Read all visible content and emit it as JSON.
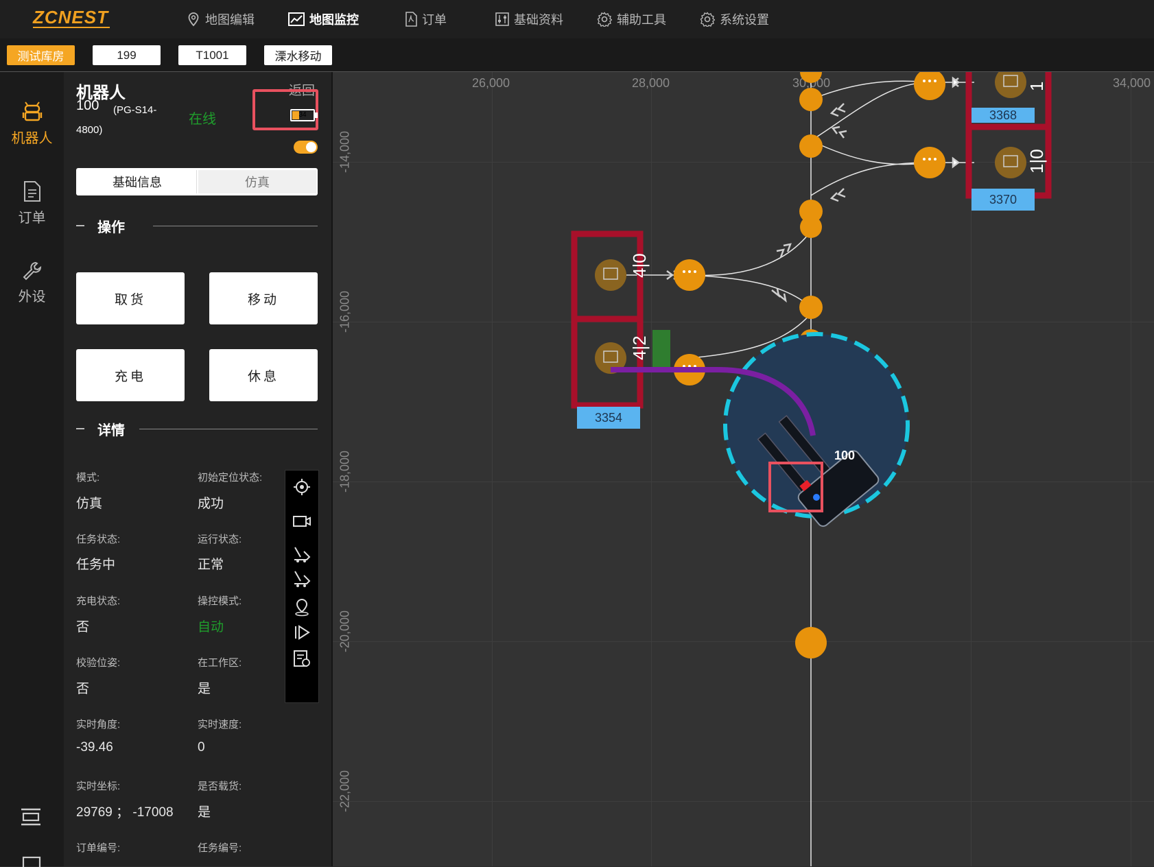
{
  "app": {
    "logo_text": "ZCNEST"
  },
  "nav": [
    {
      "label": "地图编辑",
      "icon": "map-pin-icon"
    },
    {
      "label": "地图监控",
      "icon": "chart-line-icon",
      "active": true
    },
    {
      "label": "订单",
      "icon": "pdf-document-icon"
    },
    {
      "label": "基础资料",
      "icon": "sliders-icon"
    },
    {
      "label": "辅助工具",
      "icon": "gear-icon"
    },
    {
      "label": "系统设置",
      "icon": "gear-icon"
    }
  ],
  "subbar": {
    "warehouse": "测试库房",
    "field_1": "199",
    "field_2": "T1001",
    "field_3": "溧水移动"
  },
  "rail": [
    {
      "label": "机器人",
      "icon": "android-robot-icon",
      "active": true
    },
    {
      "label": "订单",
      "icon": "document-icon"
    },
    {
      "label": "外设",
      "icon": "wrench-icon"
    }
  ],
  "robot": {
    "title": "机器人",
    "id": "100",
    "model_line1": "(PG-S14-",
    "model_line2": "4800)",
    "status": "在线",
    "back_label": "返回",
    "battery": 34,
    "toggle_on": true
  },
  "tabs": {
    "basic": "基础信息",
    "sim": "仿真"
  },
  "operations": {
    "title": "操作",
    "buttons": [
      "取货",
      "移动",
      "充电",
      "休息"
    ]
  },
  "details": {
    "title": "详情",
    "fields": [
      {
        "label": "模式:",
        "value": "仿真"
      },
      {
        "label": "初始定位状态:",
        "value": "成功"
      },
      {
        "label": "任务状态:",
        "value": "任务中"
      },
      {
        "label": "运行状态:",
        "value": "正常"
      },
      {
        "label": "充电状态:",
        "value": "否"
      },
      {
        "label": "操控模式:",
        "value": "自动",
        "color": "#1f9e2c"
      },
      {
        "label": "校验位姿:",
        "value": "否"
      },
      {
        "label": "在工作区:",
        "value": "是"
      },
      {
        "label": "实时角度:",
        "value": "-39.46"
      },
      {
        "label": "实时速度:",
        "value": "0"
      },
      {
        "label": "实时坐标:",
        "value": "29769 ； -17008"
      },
      {
        "label": "是否载货:",
        "value": "是"
      },
      {
        "label": "订单编号:",
        "value": ""
      },
      {
        "label": "任务编号:",
        "value": ""
      }
    ]
  },
  "tools": [
    "locate-target-icon",
    "camera-icon",
    "forklift-icon",
    "forklift-down-icon",
    "location-pin-icon",
    "play-step-icon",
    "report-icon"
  ],
  "map": {
    "x_ticks": [
      "26,000",
      "28,000",
      "30,000",
      "34,000"
    ],
    "y_ticks": [
      "-14,000",
      "-16,000",
      "-18,000",
      "-20,000",
      "-22,000"
    ],
    "shelves": [
      "3354",
      "3368",
      "3370"
    ],
    "shelf_codes": [
      "4|0",
      "4|2",
      "1",
      "1|0"
    ],
    "robot_label": "100",
    "colors": {
      "node": "#e8930c",
      "shelf_frame": "#a8102a",
      "shelf_label": "#5ab4f0",
      "path": "#7b1fa2",
      "safety_ring": "#1bc7e0",
      "highlight": "#e8515f"
    }
  }
}
